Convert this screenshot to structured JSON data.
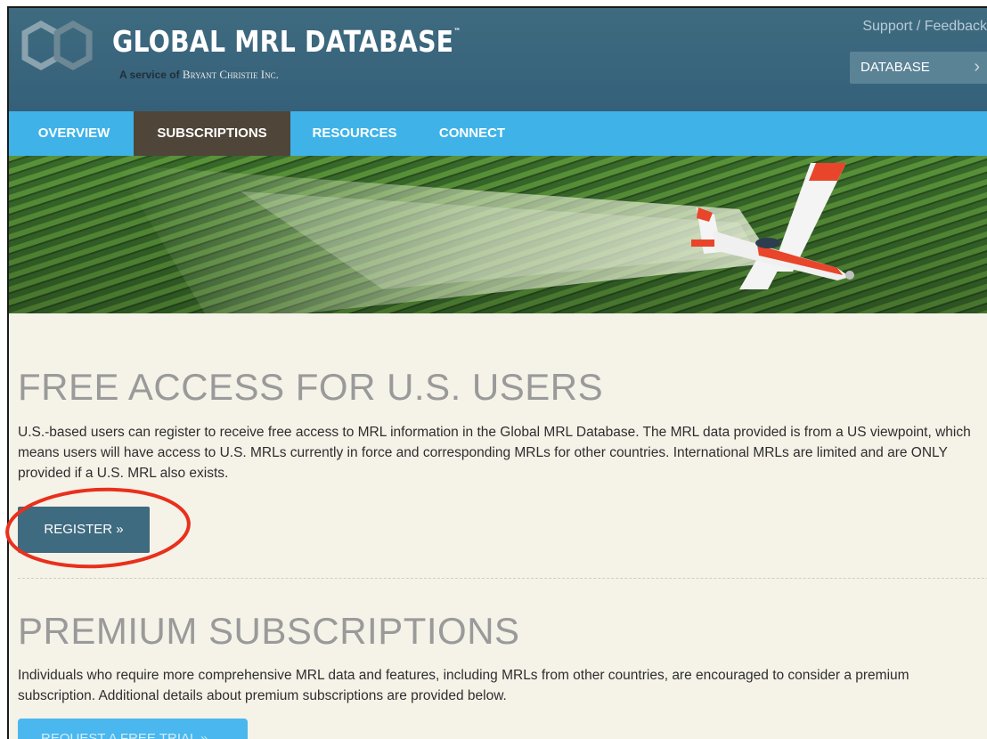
{
  "header": {
    "logo_title": "GLOBAL MRL DATABASE",
    "trademark": "™",
    "service_prefix": "A service of ",
    "company": "Bryant Christie Inc.",
    "support_link": "Support / Feedback",
    "database_button": "DATABASE",
    "chevron": "›"
  },
  "nav": {
    "items": [
      {
        "label": "OVERVIEW"
      },
      {
        "label": "SUBSCRIPTIONS"
      },
      {
        "label": "RESOURCES"
      },
      {
        "label": "CONNECT"
      }
    ],
    "active": "SUBSCRIPTIONS"
  },
  "free_access": {
    "heading": "FREE ACCESS FOR U.S. USERS",
    "body": "U.S.-based users can register to receive free access to MRL information in the Global MRL Database. The MRL data provided is from a US viewpoint, which means users will have access to U.S. MRLs currently in force and corresponding MRLs for other countries. International MRLs are limited and are ONLY provided if a U.S. MRL also exists.",
    "button": "REGISTER »"
  },
  "premium": {
    "heading": "PREMIUM SUBSCRIPTIONS",
    "body": "Individuals who require more comprehensive MRL data and features, including MRLs from other countries, are encouraged to consider a premium subscription. Additional details about premium subscriptions are provided below.",
    "button": "REQUEST A FREE TRIAL »"
  },
  "colors": {
    "header_bg": "#3f6b80",
    "nav_bg": "#3fb3e8",
    "nav_active_bg": "#4f4538",
    "page_bg": "#f5f2e8",
    "register_bg": "#3f6b80",
    "trial_bg": "#4ab7ee",
    "annotation": "#e8301c"
  },
  "icons": {
    "logo": "interlocking-hexagons-logo",
    "chevron": "chevron-right-icon",
    "hero": "crop-duster-plane-photo"
  }
}
